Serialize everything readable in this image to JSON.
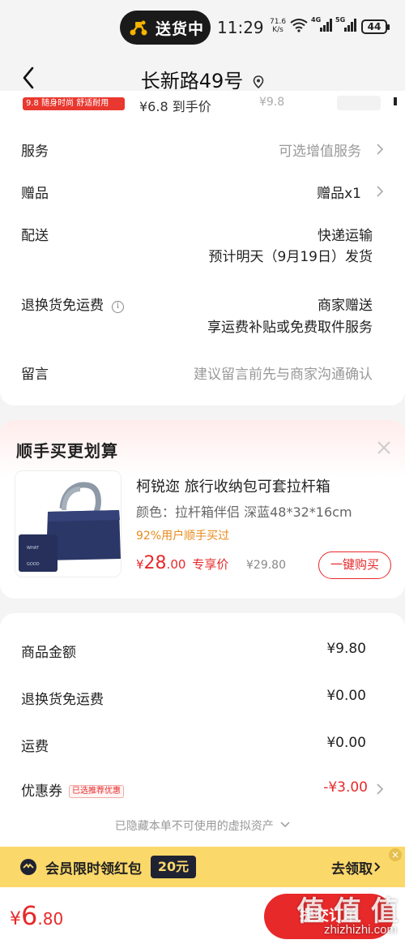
{
  "status_bar": {
    "pill_text": "送货中",
    "time": "11:29",
    "net_speed_value": "71.6",
    "net_speed_unit": "K/s",
    "signal_a": "4G",
    "signal_b": "5G",
    "battery": "44"
  },
  "nav": {
    "title": "长新路49号"
  },
  "peek_row": {
    "tag": "9.8 随身时尚 舒适耐用",
    "price": "¥6.8 到手价",
    "orig": "¥9.8"
  },
  "order_rows": {
    "service": {
      "label": "服务",
      "value": "可选增值服务"
    },
    "gift": {
      "label": "赠品",
      "value": "赠品x1"
    },
    "delivery": {
      "label": "配送",
      "value": "快递运输",
      "detail": "预计明天（9月19日）发货"
    },
    "return_shipping": {
      "label": "退换货免运费",
      "value": "商家赠送",
      "detail": "享运费补贴或免费取件服务"
    },
    "message": {
      "label": "留言",
      "placeholder": "建议留言前先与商家沟通确认"
    }
  },
  "suggest": {
    "title": "顺手买更划算",
    "product": {
      "name": "柯锐迩 旅行收纳包可套拉杆箱",
      "spec": "颜色：拉杆箱伴侣 深蓝48*32*16cm",
      "bought": "92%用户顺手买过",
      "price_symbol": "¥",
      "price_int": "28",
      "price_dec": ".00",
      "price_label": "专享价",
      "orig_price": "¥29.80",
      "buy_label": "一键购买"
    }
  },
  "summary": {
    "goods": {
      "label": "商品金额",
      "value": "¥9.80"
    },
    "return_fee": {
      "label": "退换货免运费",
      "value": "¥0.00"
    },
    "shipping": {
      "label": "运费",
      "value": "¥0.00"
    },
    "coupon": {
      "label": "优惠券",
      "badge": "已选推荐优惠",
      "value": "-¥3.00"
    },
    "hidden_note": "已隐藏本单不可使用的虚拟资产"
  },
  "member_banner": {
    "text": "会员限时领红包",
    "amount": "20元",
    "action": "去领取"
  },
  "bottom_bar": {
    "total_symbol": "¥",
    "total_int": "6",
    "total_dec": ".80",
    "submit_label": "提交订单"
  },
  "watermark": {
    "main": "值 值 值",
    "sub": "zhizhizhi.com"
  },
  "colors": {
    "accent_red": "#e8292a",
    "member_yellow": "#fbd86a",
    "bought_orange": "#e98a1c"
  },
  "icons": [
    "scooter-icon",
    "wifi-icon",
    "signal-icon",
    "battery-icon",
    "back-icon",
    "location-pin-icon",
    "chevron-right-icon",
    "info-icon",
    "close-icon",
    "member-badge-icon"
  ]
}
